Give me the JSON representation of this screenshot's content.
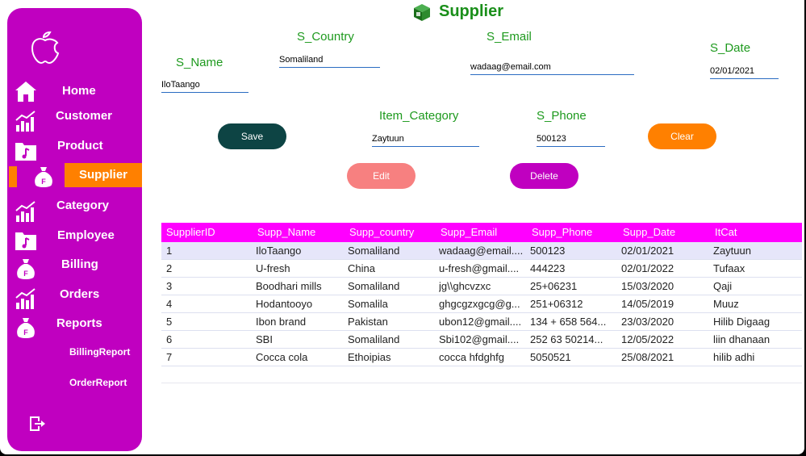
{
  "sidebar": {
    "items": [
      {
        "label": "Home",
        "icon": "home-icon"
      },
      {
        "label": "Customer",
        "icon": "chart-icon"
      },
      {
        "label": "Product",
        "icon": "music-folder-icon"
      },
      {
        "label": "Supplier",
        "icon": "money-bag-icon"
      },
      {
        "label": "Category",
        "icon": "chart-icon"
      },
      {
        "label": "Employee",
        "icon": "music-folder-icon"
      },
      {
        "label": "Billing",
        "icon": "money-bag-icon"
      },
      {
        "label": "Orders",
        "icon": "chart-icon"
      },
      {
        "label": "Reports",
        "icon": "money-bag-icon"
      }
    ],
    "sub_items": [
      "BillingReport",
      "OrderReport"
    ],
    "active": "Supplier"
  },
  "page": {
    "title": "Supplier"
  },
  "form": {
    "s_name": {
      "label": "S_Name",
      "value": "IloTaango"
    },
    "s_country": {
      "label": "S_Country",
      "value": "Somaliland"
    },
    "s_email": {
      "label": "S_Email",
      "value": "wadaag@email.com"
    },
    "s_date": {
      "label": "S_Date",
      "value": "02/01/2021"
    },
    "item_category": {
      "label": "Item_Category",
      "value": "Zaytuun"
    },
    "s_phone": {
      "label": "S_Phone",
      "value": "500123"
    }
  },
  "buttons": {
    "save": "Save",
    "clear": "Clear",
    "edit": "Edit",
    "delete": "Delete"
  },
  "colors": {
    "sidebar": "#c000c0",
    "accent": "#ff8000",
    "header": "#ff00ff",
    "title": "#1a8f1a",
    "save": "#0d4444",
    "edit": "#f78080",
    "delete": "#c000c0"
  },
  "grid": {
    "columns": [
      "SupplierID",
      "Supp_Name",
      "Supp_country",
      "Supp_Email",
      "Supp_Phone",
      "Supp_Date",
      "ItCat"
    ],
    "rows": [
      [
        "1",
        "IloTaango",
        "Somaliland",
        "wadaag@email....",
        "500123",
        "02/01/2021",
        "Zaytuun"
      ],
      [
        "2",
        "U-fresh",
        "China",
        "u-fresh@gmail....",
        "444223",
        "02/01/2022",
        "Tufaax"
      ],
      [
        "3",
        "Boodhari mills",
        "Somaliland",
        "jg\\\\ghcvzxc",
        "25+06231",
        "15/03/2020",
        "Qaji"
      ],
      [
        "4",
        "Hodantooyo",
        "Somalila",
        "ghgcgzxgcg@g...",
        "251+06312",
        "14/05/2019",
        "Muuz"
      ],
      [
        "5",
        "Ibon brand",
        "Pakistan",
        "ubon12@gmail....",
        "134 + 658 564...",
        "23/03/2020",
        "Hilib Digaag"
      ],
      [
        "6",
        "SBI",
        "Somaliland",
        "Sbi102@gmail....",
        "252 63 50214...",
        "12/05/2022",
        "liin dhanaan"
      ],
      [
        "7",
        "Cocca cola",
        "Ethoipias",
        "cocca hfdghfg",
        "5050521",
        "25/08/2021",
        "hilib adhi"
      ]
    ],
    "selected_row": 0
  }
}
